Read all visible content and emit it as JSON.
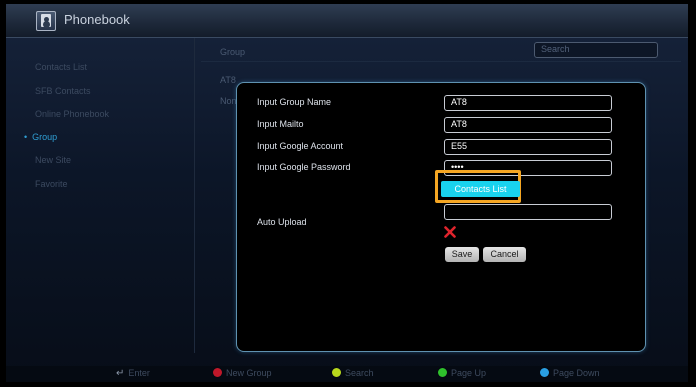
{
  "app": {
    "title": "Phonebook"
  },
  "sidebar": {
    "items": [
      {
        "label": "Contacts List"
      },
      {
        "label": "SFB Contacts"
      },
      {
        "label": "Online Phonebook"
      },
      {
        "label": "Group",
        "active": true
      },
      {
        "label": "New Site"
      },
      {
        "label": "Favorite"
      }
    ]
  },
  "panel": {
    "header": "Group",
    "search_label": "Search",
    "rows": [
      "AT8",
      "Non"
    ]
  },
  "dialog": {
    "fields": [
      {
        "label": "Input Group Name",
        "value": "AT8"
      },
      {
        "label": "Input Mailto",
        "value": "AT8"
      },
      {
        "label": "Input Google Account",
        "value": "E55"
      },
      {
        "label": "Input Google Password",
        "value": "••••"
      }
    ],
    "contacts_list_button": "Contacts List",
    "extra_input_value": "",
    "auto_upload_label": "Auto Upload",
    "auto_upload_state": "disabled",
    "save_label": "Save",
    "cancel_label": "Cancel"
  },
  "footer": {
    "items": [
      {
        "label": "Enter",
        "icon": "enter-icon"
      },
      {
        "label": "New Group",
        "color": "#c0182a"
      },
      {
        "label": "Search",
        "color": "#b8d81c"
      },
      {
        "label": "Page Up",
        "color": "#2fc12c"
      },
      {
        "label": "Page Down",
        "color": "#2aa0e4"
      }
    ]
  },
  "colors": {
    "accent": "#19d3ee",
    "highlight": "#f5a623",
    "active_nav": "#2f9fd4",
    "error_x": "#e0242c"
  }
}
